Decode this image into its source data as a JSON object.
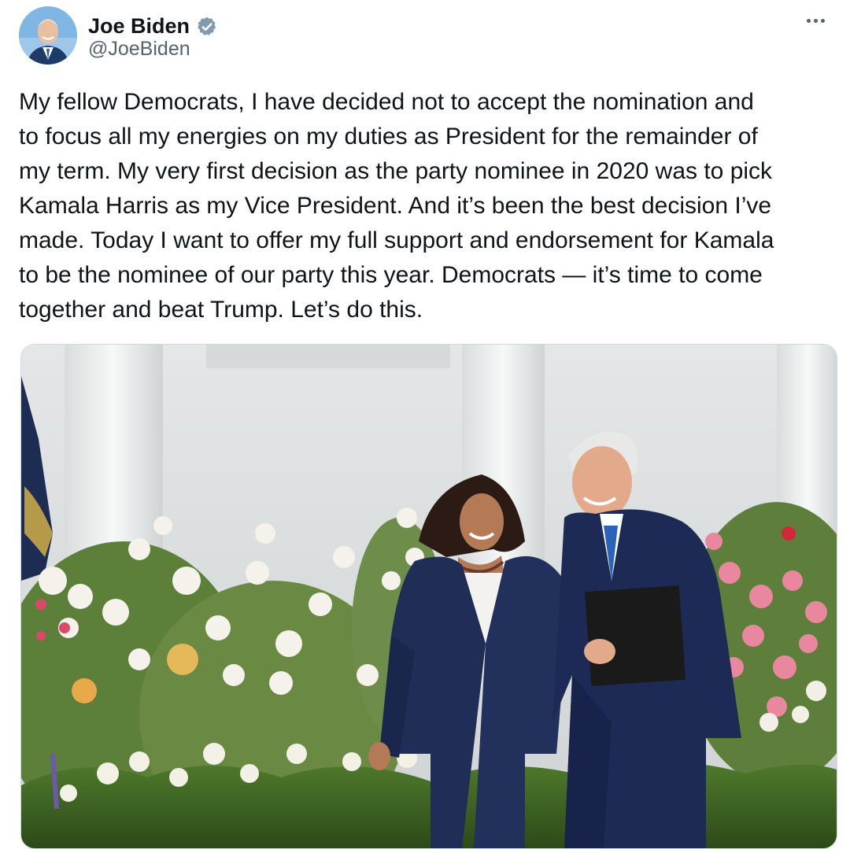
{
  "author": {
    "display_name": "Joe Biden",
    "handle": "@JoeBiden",
    "verified_icon": "verified-badge-icon",
    "avatar_icon": "avatar-photo"
  },
  "tweet": {
    "text": "My fellow Democrats, I have decided not to accept the nomination and\nto focus all my energies on my duties as President for the remainder of\nmy term. My very first decision as the party nominee in 2020 was to pick\nKamala Harris as my Vice President. And it’s been the best decision I’ve\nmade. Today I want to offer my full support and endorsement for Kamala\nto be the nominee of our party this year. Democrats — it’s time to come\ntogether and beat Trump. Let’s do this."
  },
  "media": {
    "kind": "photo"
  },
  "colors": {
    "text": "#0f1419",
    "secondary": "#536471",
    "verified": "#829aab",
    "border": "#cfd9de"
  }
}
